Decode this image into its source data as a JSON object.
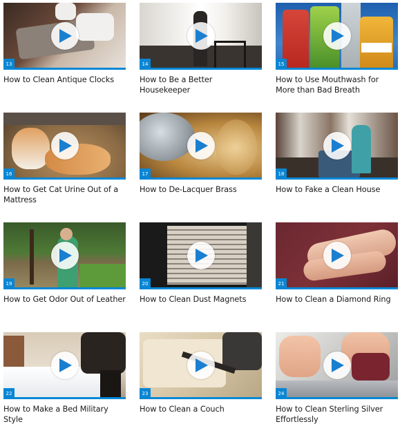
{
  "videos": [
    {
      "num": "13",
      "title": "How to Clean Antique Clocks"
    },
    {
      "num": "14",
      "title": "How to Be a Better Housekeeper"
    },
    {
      "num": "15",
      "title": "How to Use Mouthwash for More than Bad Breath"
    },
    {
      "num": "16",
      "title": "How to Get Cat Urine Out of a Mattress"
    },
    {
      "num": "17",
      "title": "How to De-Lacquer Brass"
    },
    {
      "num": "18",
      "title": "How to Fake a Clean House"
    },
    {
      "num": "19",
      "title": "How to Get Odor Out of Leather"
    },
    {
      "num": "20",
      "title": "How to Clean Dust Magnets"
    },
    {
      "num": "21",
      "title": "How to Clean a Diamond Ring"
    },
    {
      "num": "22",
      "title": "How to Make a Bed Military Style"
    },
    {
      "num": "23",
      "title": "How to Clean a Couch"
    },
    {
      "num": "24",
      "title": "How to Clean Sterling Silver Effortlessly"
    }
  ],
  "colors": {
    "accent": "#0a86d4",
    "play_icon": "#1a7fd0"
  },
  "icons": {
    "play": "play-icon"
  }
}
